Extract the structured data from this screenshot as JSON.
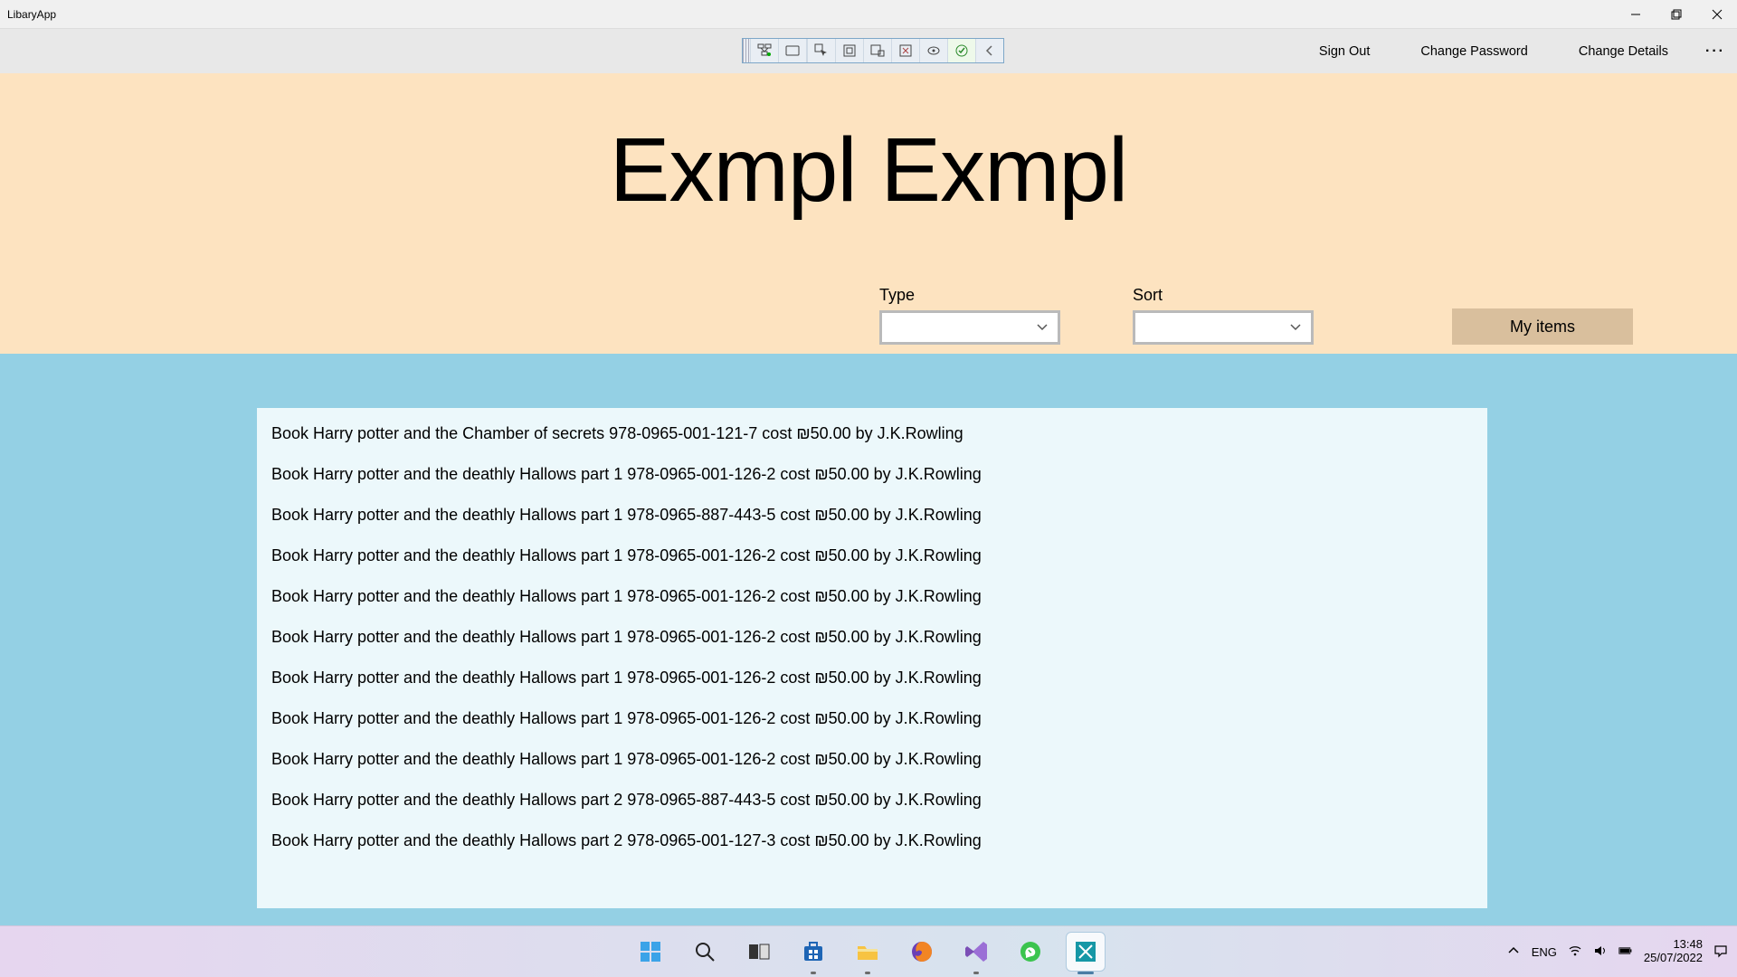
{
  "window": {
    "title": "LibaryApp"
  },
  "commands": {
    "sign_out": "Sign Out",
    "change_password": "Change Password",
    "change_details": "Change Details"
  },
  "hero": {
    "title": "Exmpl Exmpl",
    "type_label": "Type",
    "sort_label": "Sort",
    "my_items": "My items"
  },
  "items": [
    "Book Harry potter and the Chamber of secrets 978-0965-001-121-7 cost ₪50.00 by J.K.Rowling",
    "Book Harry potter and the deathly Hallows part 1 978-0965-001-126-2 cost ₪50.00 by J.K.Rowling",
    "Book Harry potter and the deathly Hallows part 1 978-0965-887-443-5 cost ₪50.00 by J.K.Rowling",
    "Book Harry potter and the deathly Hallows part 1 978-0965-001-126-2 cost ₪50.00 by J.K.Rowling",
    "Book Harry potter and the deathly Hallows part 1 978-0965-001-126-2 cost ₪50.00 by J.K.Rowling",
    "Book Harry potter and the deathly Hallows part 1 978-0965-001-126-2 cost ₪50.00 by J.K.Rowling",
    "Book Harry potter and the deathly Hallows part 1 978-0965-001-126-2 cost ₪50.00 by J.K.Rowling",
    "Book Harry potter and the deathly Hallows part 1 978-0965-001-126-2 cost ₪50.00 by J.K.Rowling",
    "Book Harry potter and the deathly Hallows part 1 978-0965-001-126-2 cost ₪50.00 by J.K.Rowling",
    "Book Harry potter and the deathly Hallows part 2 978-0965-887-443-5 cost ₪50.00 by J.K.Rowling",
    "Book Harry potter and the deathly Hallows part 2 978-0965-001-127-3 cost ₪50.00 by J.K.Rowling"
  ],
  "tray": {
    "lang": "ENG",
    "time": "13:48",
    "date": "25/07/2022"
  }
}
